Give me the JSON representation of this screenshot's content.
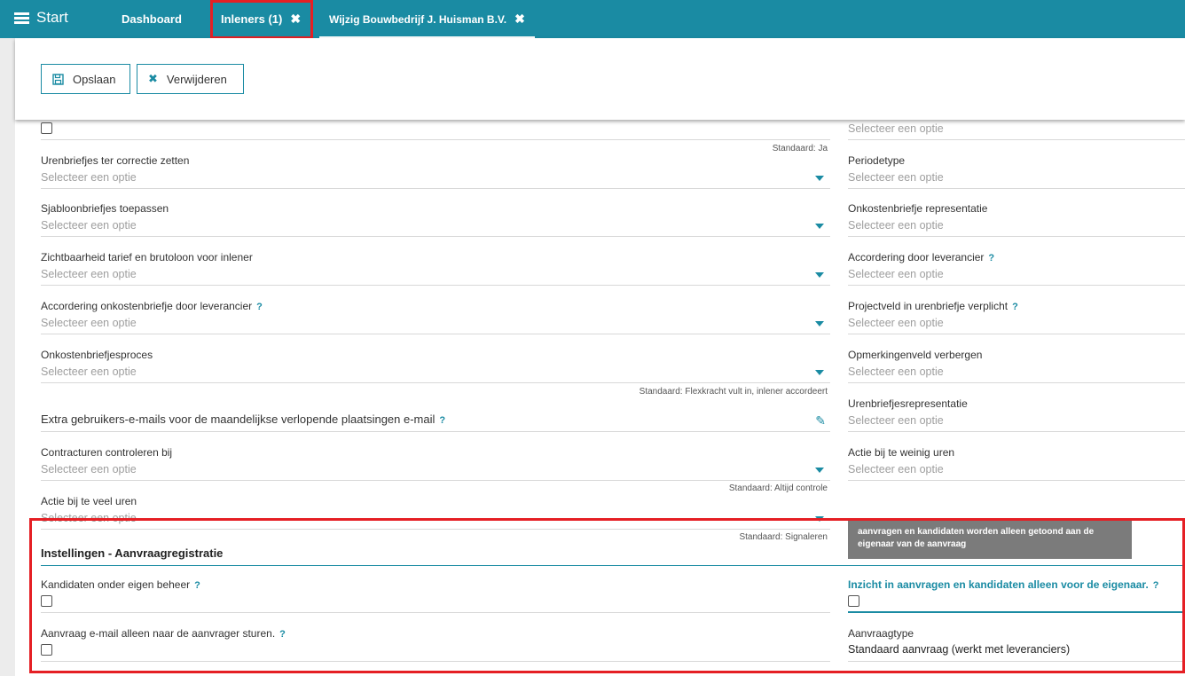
{
  "topbar": {
    "start_label": "Start",
    "tabs": [
      {
        "label": "Dashboard"
      },
      {
        "label": "Inleners (1)",
        "close": "✖"
      },
      {
        "label": "Wijzig Bouwbedrijf J. Huisman B.V.",
        "close": "✖"
      }
    ]
  },
  "toolbar": {
    "save_label": "Opslaan",
    "delete_label": "Verwijderen"
  },
  "form": {
    "placeholder": "Selecteer een optie",
    "hint_top": "Standaard: Ja",
    "left": [
      {
        "label": "Urenbriefjes ter correctie zetten"
      },
      {
        "label": "Sjabloonbriefjes toepassen"
      },
      {
        "label": "Zichtbaarheid tarief en brutoloon voor inlener"
      },
      {
        "label": "Accordering onkostenbriefje door leverancier"
      },
      {
        "label": "Onkostenbriefjesproces",
        "hint": "Standaard: Flexkracht vult in, inlener accordeert"
      },
      {
        "label": "Extra gebruikers-e-mails voor de maandelijkse verlopende plaatsingen e-mail"
      },
      {
        "label": "Contracturen controleren bij",
        "hint": "Standaard: Altijd controle"
      },
      {
        "label": "Actie bij te veel uren",
        "hint": "Standaard: Signaleren"
      }
    ],
    "right": [
      {
        "label": "Periodetype"
      },
      {
        "label": "Onkostenbriefje representatie"
      },
      {
        "label": "Accordering door leverancier"
      },
      {
        "label": "Projectveld in urenbriefje verplicht"
      },
      {
        "label": "Opmerkingenveld verbergen"
      },
      {
        "label": "Urenbriefjesrepresentatie"
      },
      {
        "label": "Actie bij te weinig uren"
      }
    ]
  },
  "section": {
    "title": "Instellingen - Aanvraagregistratie",
    "tooltip": "aanvragen en kandidaten worden alleen getoond aan de eigenaar van de aanvraag",
    "kandidaten_label": "Kandidaten onder eigen beheer",
    "email_label": "Aanvraag e-mail alleen naar de aanvrager sturen.",
    "inzicht_label": "Inzicht in aanvragen en kandidaten alleen voor de eigenaar.",
    "aanvraagtype_label": "Aanvraagtype",
    "aanvraagtype_value": "Standaard aanvraag (werkt met leveranciers)"
  },
  "help_mark": "?"
}
